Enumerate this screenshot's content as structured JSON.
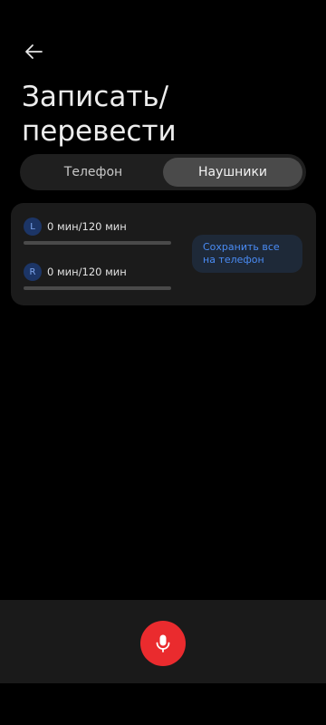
{
  "header": {
    "back_icon": "arrow-left-icon",
    "title": "Записать/\nперевести"
  },
  "segmented": {
    "options": [
      {
        "label": "Телефон",
        "active": false
      },
      {
        "label": "Наушники",
        "active": true
      }
    ]
  },
  "recordings": {
    "left": {
      "badge": "L",
      "text": "0 мин/120 мин",
      "progress": 0
    },
    "right": {
      "badge": "R",
      "text": "0 мин/120 мин",
      "progress": 0
    },
    "save_label": "Сохранить все на телефон"
  },
  "bottom": {
    "mic_icon": "microphone-icon"
  },
  "colors": {
    "accent": "#4a8cf5",
    "record": "#ea2b2e",
    "background": "#000000"
  }
}
